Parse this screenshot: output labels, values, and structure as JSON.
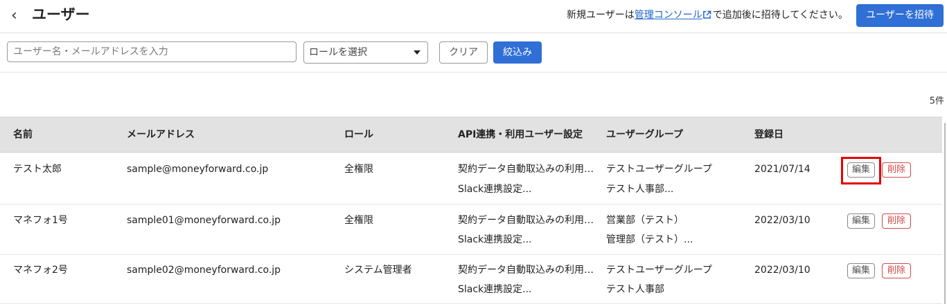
{
  "header": {
    "back_icon": "‹",
    "title": "ユーザー",
    "notice_prefix": "新規ユーザーは",
    "notice_link": "管理コンソール",
    "notice_suffix": "で追加後に招待してください。",
    "invite_button": "ユーザーを招待",
    "accent_color": "#2f6fd6"
  },
  "filters": {
    "search_placeholder": "ユーザー名・メールアドレスを入力",
    "search_value": "",
    "role_select": "ロールを選択",
    "clear_button": "クリア",
    "filter_button": "絞込み"
  },
  "count": "5件",
  "table": {
    "columns": [
      "名前",
      "メールアドレス",
      "ロール",
      "API連携・利用ユーザー設定",
      "ユーザーグループ",
      "登録日"
    ],
    "rows": [
      {
        "name": "テスト太郎",
        "email": "sample@moneyforward.co.jp",
        "role": "全権限",
        "api_1": "契約データ自動取込みの利用…",
        "api_2": "Slack連携設定...",
        "group_1": "テストユーザーグループ",
        "group_2": "テスト人事部...",
        "date": "2021/07/14",
        "edit": "編集",
        "delete": "削除"
      },
      {
        "name": "マネフォ1号",
        "email": "sample01@moneyforward.co.jp",
        "role": "全権限",
        "api_1": "契約データ自動取込みの利用…",
        "api_2": "Slack連携設定...",
        "group_1": "営業部（テスト）",
        "group_2": "管理部（テスト）...",
        "date": "2022/03/10",
        "edit": "編集",
        "delete": "削除"
      },
      {
        "name": "マネフォ2号",
        "email": "sample02@moneyforward.co.jp",
        "role": "システム管理者",
        "api_1": "契約データ自動取込みの利用…",
        "api_2": "Slack連携設定...",
        "group_1": "テストユーザーグループ",
        "group_2": "テスト人事部",
        "date": "2022/03/10",
        "edit": "編集",
        "delete": "削除"
      }
    ]
  }
}
